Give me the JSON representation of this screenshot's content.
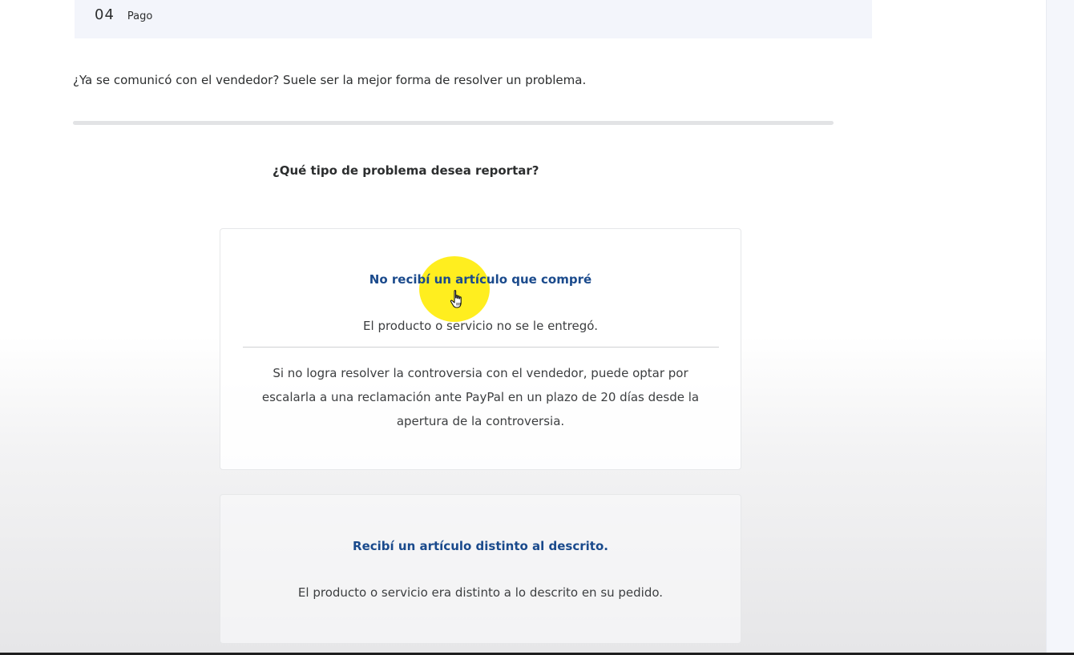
{
  "header": {
    "step_number": "04",
    "step_label": "Pago"
  },
  "main": {
    "contact_prompt": "¿Ya se comunicó con el vendedor? Suele ser la mejor forma de resolver un problema.",
    "question": "¿Qué tipo de problema desea reportar?",
    "options": [
      {
        "title": "No recibí un artículo que compré",
        "description": "El producto o servicio no se le entregó.",
        "note_lines": [
          "Si no logra resolver la controversia con el vendedor, puede optar por",
          "escalarla a una reclamación ante PayPal en un plazo de 20 días desde la",
          "apertura de la controversia."
        ]
      },
      {
        "title": "Recibí un artículo distinto al descrito.",
        "description": "El producto o servicio era distinto a lo descrito en su pedido."
      }
    ]
  },
  "colors": {
    "link": "#1a4a8c",
    "text": "#2c2e2f",
    "cursor_highlight": "#ffec00"
  },
  "icons": {
    "cursor": "hand-pointer-icon"
  }
}
